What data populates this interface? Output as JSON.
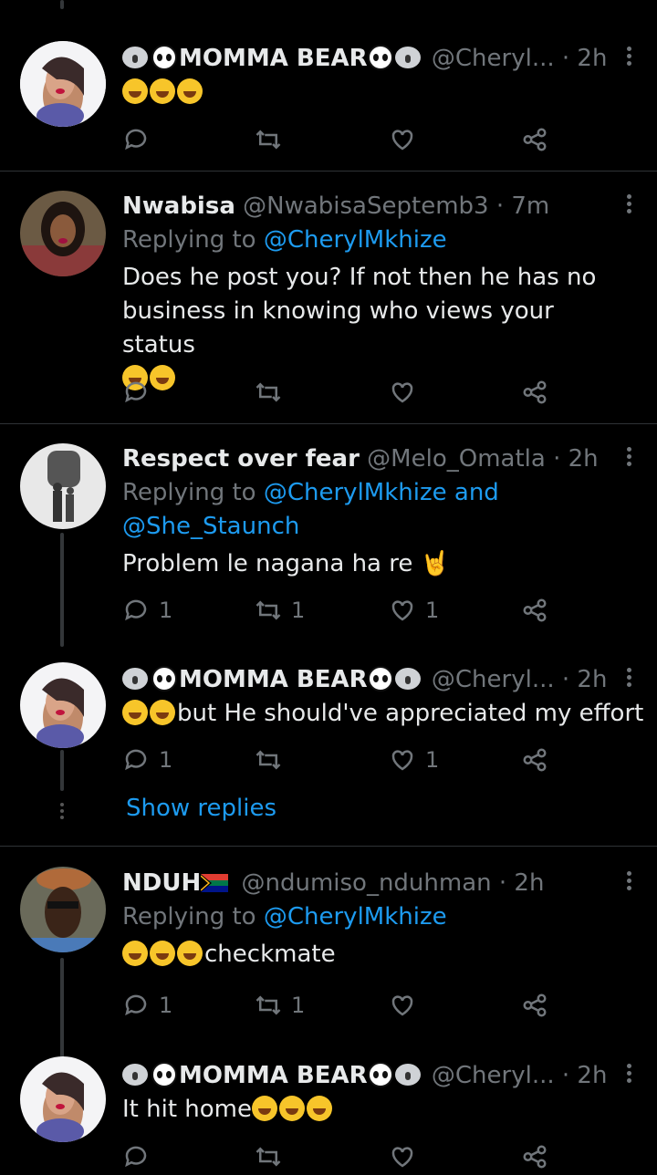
{
  "tweets": [
    {
      "name": "🐨🐼MOMMA BEAR🐼🐨",
      "name_text": "MOMMA BEAR",
      "handle": "@Cheryl...",
      "time": "· 2h",
      "replying_prefix": "",
      "replying_mentions": "",
      "text": "🤣🤣🤣",
      "reply_count": "",
      "retweet_count": "",
      "like_count": ""
    },
    {
      "name": "Nwabisa",
      "handle": "@NwabisaSeptemb3",
      "time": "· 7m",
      "replying_prefix": "Replying to",
      "replying_mentions": "@CherylMkhize",
      "text": "Does he post you? If not then he has no business in knowing who views your status",
      "trailing_emoji": "🤣🤣",
      "reply_count": "",
      "retweet_count": "",
      "like_count": ""
    },
    {
      "name": "Respect over fear",
      "handle": "@Melo_Omatla",
      "time": "· 2h",
      "replying_prefix": "Replying to",
      "replying_mentions": "@CherylMkhize and @She_Staunch",
      "text": "Problem le nagana ha re 🤘",
      "reply_count": "1",
      "retweet_count": "1",
      "like_count": "1"
    },
    {
      "name": "🐨🐼MOMMA BEAR🐼🐨",
      "name_text": "MOMMA BEAR",
      "handle": "@Cheryl...",
      "time": "· 2h",
      "text": "but He should've appreciated my effort",
      "leading_emoji": "🤣🤣",
      "reply_count": "1",
      "retweet_count": "",
      "like_count": "1"
    },
    {
      "name": "NDUH🇿🇦",
      "name_text": "NDUH",
      "handle": "@ndumiso_nduhman",
      "time": "· 2h",
      "replying_prefix": "Replying to",
      "replying_mentions": "@CherylMkhize",
      "text": "checkmate",
      "leading_emoji": "😂😂😂",
      "reply_count": "1",
      "retweet_count": "1",
      "like_count": ""
    },
    {
      "name": "🐨🐼MOMMA BEAR🐼🐨",
      "name_text": "MOMMA BEAR",
      "handle": "@Cheryl...",
      "time": "· 2h",
      "text": "It hit home",
      "trailing_emoji": "🤣🤣🤣"
    }
  ],
  "show_replies_label": "Show replies",
  "icons": [
    "reply-icon",
    "retweet-icon",
    "like-icon",
    "share-icon",
    "more-icon"
  ],
  "colors": {
    "background": "#000000",
    "text": "#e7e9ea",
    "secondary": "#71767b",
    "accent": "#1d9bf0",
    "divider": "#2f3336"
  }
}
